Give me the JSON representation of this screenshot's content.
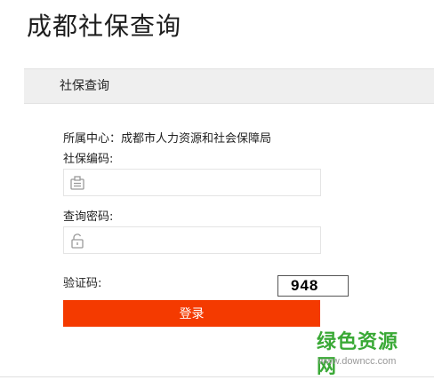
{
  "page": {
    "title": "成都社保查询"
  },
  "section": {
    "header": "社保查询"
  },
  "form": {
    "center_label": "所属中心：成都市人力资源和社会保障局",
    "code_label": "社保编码:",
    "code_value": "",
    "code_placeholder": "",
    "password_label": "查询密码:",
    "password_value": "",
    "password_placeholder": "",
    "captcha_label": "验证码:",
    "captcha_value": "948",
    "login_label": "登录"
  },
  "icons": {
    "code_field_icon": "id-card-icon",
    "password_field_icon": "unlock-icon"
  },
  "watermark": {
    "main": "绿色资源网",
    "url": "www.downcc.com"
  },
  "colors": {
    "accent": "#f43a00",
    "header_bg": "#efefef",
    "watermark": "#3aa936"
  }
}
